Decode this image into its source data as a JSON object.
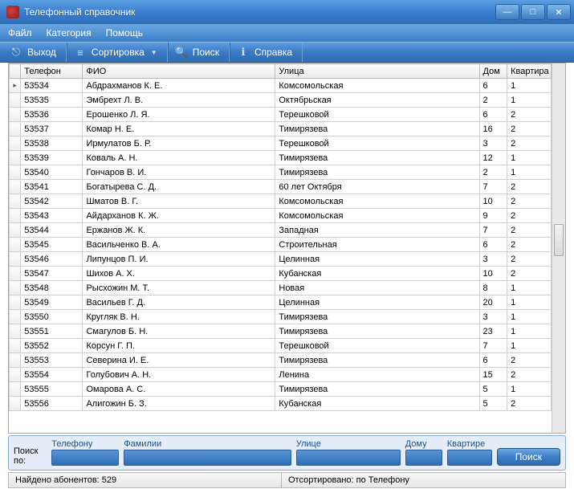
{
  "window": {
    "title": "Телефонный справочник"
  },
  "menubar": {
    "file": "Файл",
    "category": "Категория",
    "help": "Помощь"
  },
  "toolbar": {
    "exit": "Выход",
    "sort": "Сортировка",
    "search": "Поиск",
    "about": "Справка"
  },
  "columns": {
    "phone": "Телефон",
    "fio": "ФИО",
    "street": "Улица",
    "house": "Дом",
    "apt": "Квартира"
  },
  "rows": [
    {
      "phone": "53534",
      "fio": "Абдрахманов К. Е.",
      "street": "Комсомольская",
      "house": "6",
      "apt": "1"
    },
    {
      "phone": "53535",
      "fio": "Эмбрехт Л. В.",
      "street": "Октябрьская",
      "house": "2",
      "apt": "1"
    },
    {
      "phone": "53536",
      "fio": "Ерошенко Л. Я.",
      "street": "Терешковой",
      "house": "6",
      "apt": "2"
    },
    {
      "phone": "53537",
      "fio": "Комар Н. Е.",
      "street": "Тимирязева",
      "house": "16",
      "apt": "2"
    },
    {
      "phone": "53538",
      "fio": "Ирмулатов Б. Р.",
      "street": "Терешковой",
      "house": "3",
      "apt": "2"
    },
    {
      "phone": "53539",
      "fio": "Коваль А. Н.",
      "street": "Тимирязева",
      "house": "12",
      "apt": "1"
    },
    {
      "phone": "53540",
      "fio": "Гончаров В. И.",
      "street": "Тимирязева",
      "house": "2",
      "apt": "1"
    },
    {
      "phone": "53541",
      "fio": "Богатырева С. Д.",
      "street": "60 лет Октября",
      "house": "7",
      "apt": "2"
    },
    {
      "phone": "53542",
      "fio": "Шматов В. Г.",
      "street": "Комсомольская",
      "house": "10",
      "apt": "2"
    },
    {
      "phone": "53543",
      "fio": "Айдарханов К. Ж.",
      "street": "Комсомольская",
      "house": "9",
      "apt": "2"
    },
    {
      "phone": "53544",
      "fio": "Ержанов Ж. К.",
      "street": "Западная",
      "house": "7",
      "apt": "2"
    },
    {
      "phone": "53545",
      "fio": "Васильченко В. А.",
      "street": "Строительная",
      "house": "6",
      "apt": "2"
    },
    {
      "phone": "53546",
      "fio": "Липунцов П. И.",
      "street": "Целинная",
      "house": "3",
      "apt": "2"
    },
    {
      "phone": "53547",
      "fio": "Шихов А. Х.",
      "street": "Кубанская",
      "house": "10",
      "apt": "2"
    },
    {
      "phone": "53548",
      "fio": "Рысхожин М. Т.",
      "street": "Новая",
      "house": "8",
      "apt": "1"
    },
    {
      "phone": "53549",
      "fio": "Васильев Г. Д.",
      "street": "Целинная",
      "house": "20",
      "apt": "1"
    },
    {
      "phone": "53550",
      "fio": "Кругляк В. Н.",
      "street": "Тимирязева",
      "house": "3",
      "apt": "1"
    },
    {
      "phone": "53551",
      "fio": "Смагулов Б. Н.",
      "street": "Тимирязева",
      "house": "23",
      "apt": "1"
    },
    {
      "phone": "53552",
      "fio": "Корсун Г. П.",
      "street": "Терешковой",
      "house": "7",
      "apt": "1"
    },
    {
      "phone": "53553",
      "fio": "Северина И. Е.",
      "street": "Тимирязева",
      "house": "6",
      "apt": "2"
    },
    {
      "phone": "53554",
      "fio": "Голубович А. Н.",
      "street": "Ленина",
      "house": "15",
      "apt": "2"
    },
    {
      "phone": "53555",
      "fio": "Омарова А. С.",
      "street": "Тимирязева",
      "house": "5",
      "apt": "1"
    },
    {
      "phone": "53556",
      "fio": "Алигожин Б. З.",
      "street": "Кубанская",
      "house": "5",
      "apt": "2"
    }
  ],
  "searchpanel": {
    "legend": "Поиск по:",
    "phone_label": "Телефону",
    "surname_label": "Фамилии",
    "street_label": "Улице",
    "house_label": "Дому",
    "apt_label": "Квартире",
    "button": "Поиск"
  },
  "statusbar": {
    "found": "Найдено абонентов: 529",
    "sorted": "Отсортировано: по Телефону"
  }
}
